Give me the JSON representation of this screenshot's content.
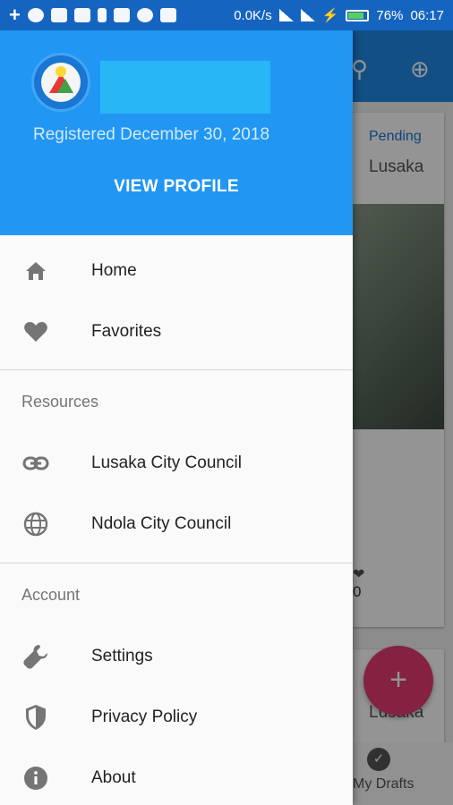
{
  "status_bar": {
    "speed": "0.0K/s",
    "battery": "76%",
    "time": "06:17"
  },
  "drawer": {
    "registered": "Registered December 30, 2018",
    "view_profile": "VIEW PROFILE",
    "items_main": [
      {
        "label": "Home",
        "icon": "home-icon"
      },
      {
        "label": "Favorites",
        "icon": "heart-icon"
      }
    ],
    "resources": {
      "header": "Resources",
      "items": [
        {
          "label": "Lusaka City Council",
          "icon": "link-icon"
        },
        {
          "label": "Ndola City Council",
          "icon": "globe-icon"
        }
      ]
    },
    "account": {
      "header": "Account",
      "items": [
        {
          "label": "Settings",
          "icon": "wrench-icon"
        },
        {
          "label": "Privacy Policy",
          "icon": "shield-icon"
        },
        {
          "label": "About",
          "icon": "info-icon"
        }
      ]
    }
  },
  "background": {
    "card1_status": "Pending",
    "card1_location": "Lusaka",
    "card1_count": "0",
    "card2_location": "Lusaka",
    "bottom_nav_label": "My Drafts",
    "fab_symbol": "+"
  },
  "colors": {
    "header_blue": "#2196f3",
    "status_bar": "#1565c0",
    "fab": "#e53970"
  }
}
